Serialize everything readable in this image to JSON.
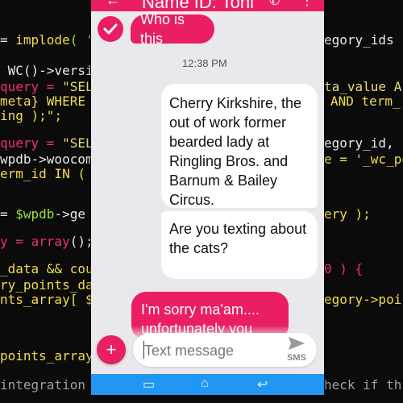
{
  "code_lines": [
    {
      "top": 0,
      "segments": [
        {
          "cls": "",
          "t": "                                          ory_ids )"
        }
      ]
    },
    {
      "top": 0,
      "segments": [
        {
          "cls": "",
          "t": ""
        }
      ]
    },
    {
      "top": 0,
      "segments": [
        {
          "cls": "",
          "t": ""
        }
      ]
    }
  ],
  "code": {
    "l1a": "= ",
    "l1b": "implode",
    "l1c": "( '",
    "l1d": "egory_ids )",
    "l2a": " WC()->versi",
    "l2b": "",
    "l3a": "query = ",
    "l3b": "\"SEL",
    "l3c": "ta_value A",
    "l4a": "meta} WHERE",
    "l4b": "AND term_",
    "l5a": "ing );\";",
    "l6a": "query = ",
    "l6b": "\"SEL",
    "l6c": "egory_id, r",
    "l7a": "wpdb->woocom",
    "l7b": "e = '_wc_po",
    "l8a": "erm_id IN (",
    "l9a": "= ",
    "l9b": "$wpdb",
    "l9c": "->ge",
    "l9d": "ery );",
    "l10a": "y = ",
    "l10b": "array",
    "l10c": "();",
    "l11a": "_data && cou",
    "l11b": "0 ) {",
    "l12a": "ry_points_da",
    "l13a": "nts_array[ $",
    "l13b": "egory->poi",
    "l14a": "points_array",
    "l15a": "integration",
    "l15b": "heck if th"
  },
  "header": {
    "back_icon": "←",
    "title": "Name ID: Toni",
    "call_icon": "✆",
    "more_icon": "⋮"
  },
  "messages": {
    "m1": "Who is this",
    "time": "12:38 PM",
    "m2": "Cherry Kirkshire, the out of work former bearded lady at Ringling Bros. and Barnum & Bailey Circus.",
    "m3": "Are you texting about the cats?",
    "m4": "I'm sorry ma'am.... unfortunately you"
  },
  "composer": {
    "add_label": "+",
    "placeholder": "Text message",
    "send_label": "SMS"
  },
  "navbar": {
    "recents_icon": "▭",
    "home_icon": "⌂",
    "back_icon": "↩"
  },
  "colors": {
    "accent": "#e91e63",
    "navbar": "#2196f3",
    "chat_background": "#e9e9ed"
  }
}
